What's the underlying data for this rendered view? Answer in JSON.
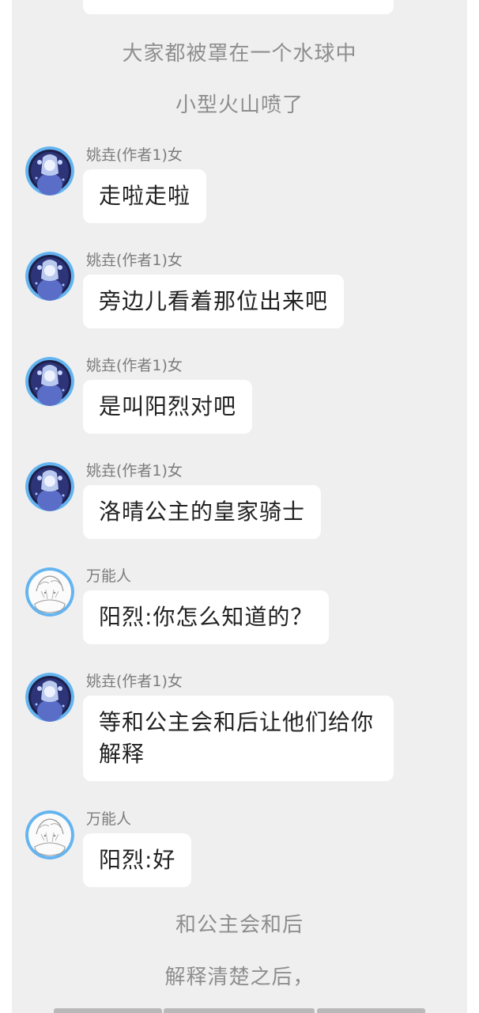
{
  "narration_top": [
    "大家都被罩在一个水球中",
    "小型火山喷了"
  ],
  "messages": [
    {
      "sender": "姚垚(作者1)女",
      "text": "走啦走啦",
      "avatar": "anime-girl-avatar"
    },
    {
      "sender": "姚垚(作者1)女",
      "text": "旁边儿看着那位出来吧",
      "avatar": "anime-girl-avatar"
    },
    {
      "sender": "姚垚(作者1)女",
      "text": "是叫阳烈对吧",
      "avatar": "anime-girl-avatar"
    },
    {
      "sender": "姚垚(作者1)女",
      "text": "洛晴公主的皇家骑士",
      "avatar": "anime-girl-avatar"
    },
    {
      "sender": "万能人",
      "text": "阳烈:你怎么知道的？",
      "avatar": "sketch-avatar"
    },
    {
      "sender": "姚垚(作者1)女",
      "text": "等和公主会和后让他们给你解释",
      "avatar": "anime-girl-avatar"
    },
    {
      "sender": "万能人",
      "text": "阳烈:好",
      "avatar": "sketch-avatar"
    }
  ],
  "narration_bottom": [
    "和公主会和后",
    "解释清楚之后，"
  ],
  "colors": {
    "background": "#efefef",
    "bubble": "#ffffff",
    "avatar_ring": "#64b4f0",
    "narration_text": "#8e8e8e"
  }
}
